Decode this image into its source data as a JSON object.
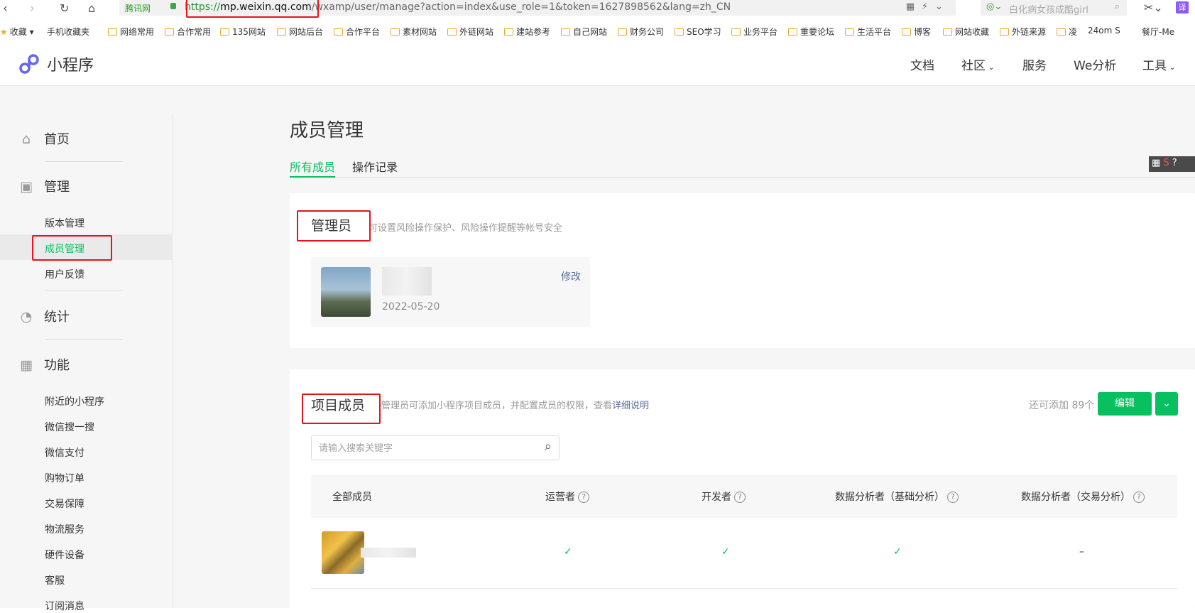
{
  "browser": {
    "security_badge": "腾讯网",
    "url_scheme": "https://",
    "url_host": "mp.weixin.qq.com",
    "url_path": "/wxamp/user/manage?action=index&use_role=1&token=1627898562&lang=zh_CN",
    "search_placeholder": "白化病女孩成酷girl",
    "translate_label": "译",
    "bookmarks": [
      "收藏",
      "手机收藏夹",
      "网络常用",
      "合作常用",
      "135网站",
      "网站后台",
      "合作平台",
      "素材网站",
      "外链网站",
      "建站参考",
      "自己网站",
      "财务公司",
      "SEO学习",
      "业务平台",
      "重要论坛",
      "生活平台",
      "博客",
      "网站收藏",
      "外链来源",
      "凌",
      "24om S",
      "餐厅-Me"
    ]
  },
  "header": {
    "logo_text": "小程序",
    "nav": [
      "文档",
      "社区",
      "服务",
      "We分析",
      "工具"
    ]
  },
  "sidebar": {
    "sections": [
      {
        "label": "首页",
        "icon": "home-icon"
      },
      {
        "label": "管理",
        "icon": "inbox-icon"
      },
      {
        "label": "统计",
        "icon": "pie-chart-icon"
      },
      {
        "label": "功能",
        "icon": "grid-icon"
      }
    ],
    "manage_items": [
      "版本管理",
      "成员管理",
      "用户反馈"
    ],
    "feature_items": [
      "附近的小程序",
      "微信搜一搜",
      "微信支付",
      "购物订单",
      "交易保障",
      "物流服务",
      "硬件设备",
      "客服",
      "订阅消息"
    ]
  },
  "main": {
    "title": "成员管理",
    "tabs": [
      "所有成员",
      "操作记录"
    ],
    "admin_card": {
      "title": "管理员",
      "desc": "可设置风险操作保护、风险操作提醒等帐号安全",
      "date": "2022-05-20",
      "edit_label": "修改"
    },
    "members_card": {
      "title": "项目成员",
      "desc": "管理员可添加小程序项目成员，并配置成员的权限，查看",
      "desc_link": "详细说明",
      "remain": "还可添加 89个",
      "edit_button": "编辑",
      "search_placeholder": "请输入搜索关键字",
      "columns": [
        "全部成员",
        "运营者",
        "开发者",
        "数据分析者（基础分析）",
        "数据分析者（交易分析）"
      ],
      "rows": [
        {
          "operator": "✓",
          "developer": "✓",
          "analyst_basic": "✓",
          "analyst_trade": "–"
        }
      ]
    }
  },
  "colors": {
    "accent": "#07c160",
    "link": "#576b95",
    "annotation": "#e3141b"
  }
}
